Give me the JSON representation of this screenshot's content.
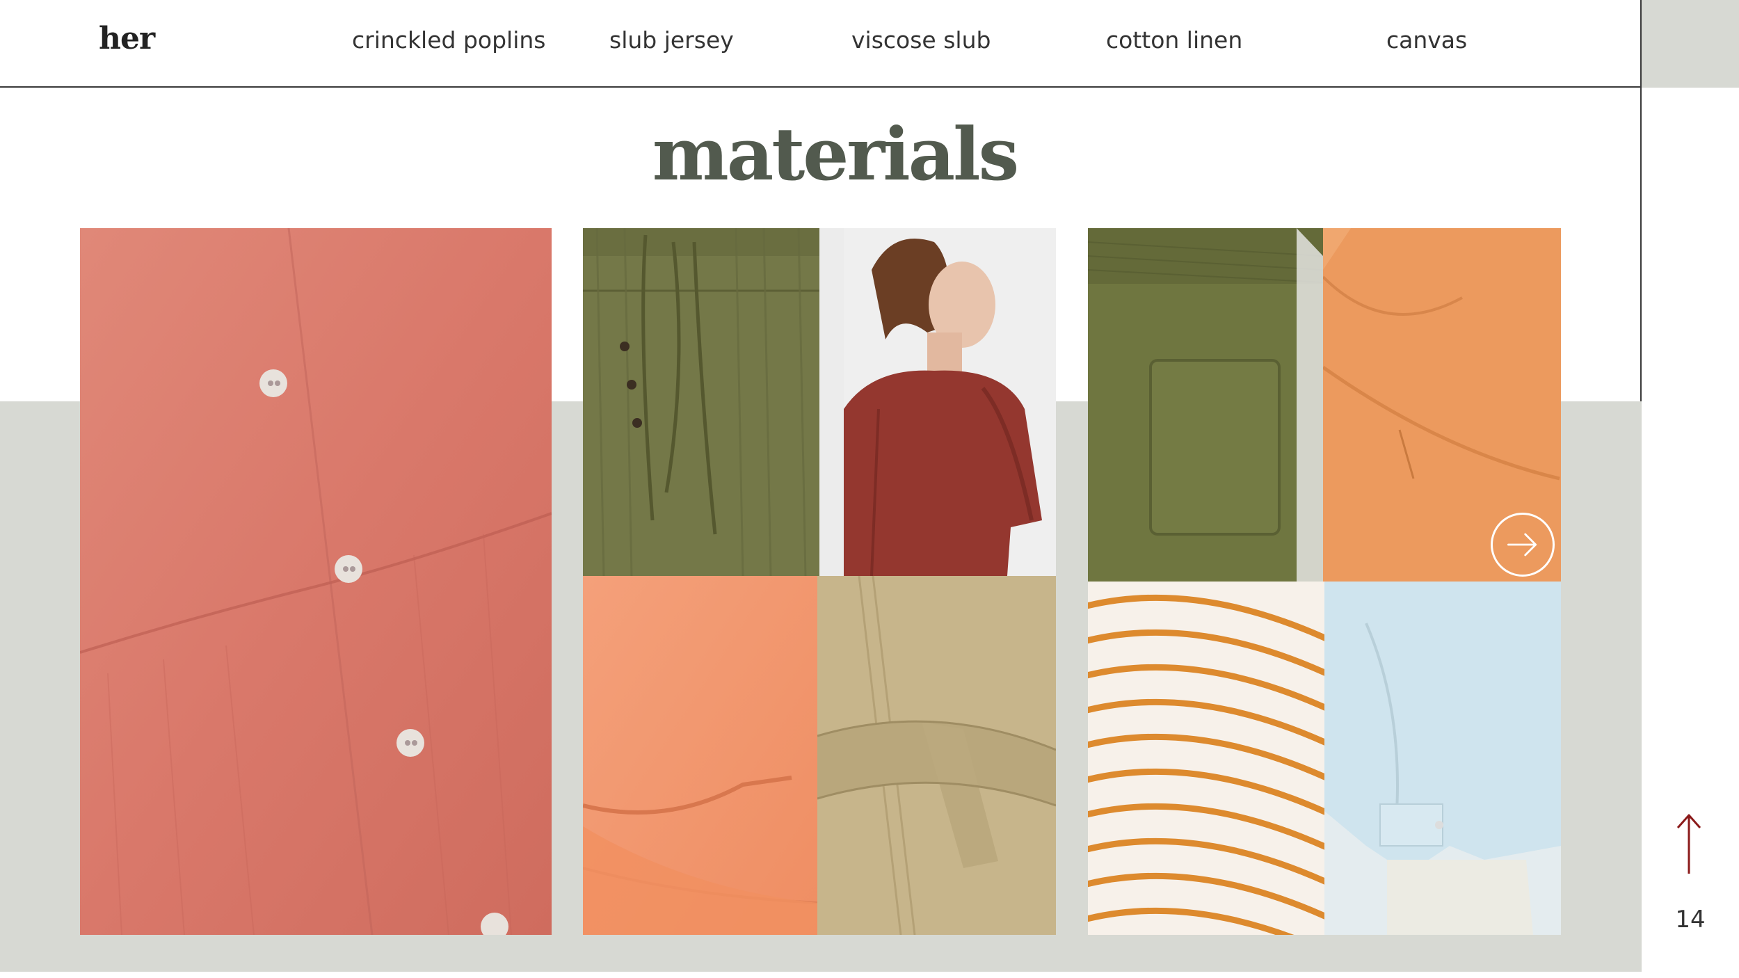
{
  "header": {
    "brand": "her",
    "nav": [
      "crinckled poplins",
      "slub jersey",
      "viscose slub",
      "cotton linen",
      "canvas"
    ]
  },
  "page_title": "materials",
  "page_number": "14",
  "icons": {
    "next": "circle-arrow-right-icon",
    "back_to_top": "arrow-up-icon"
  },
  "colors": {
    "accent_title": "#525a4e",
    "band": "#d7d9d3",
    "arrow_up": "#8b1a1a"
  }
}
